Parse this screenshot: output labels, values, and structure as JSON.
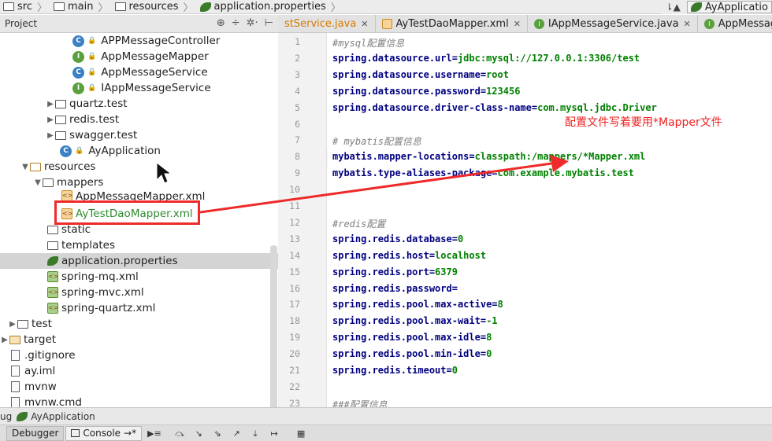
{
  "breadcrumb": {
    "items": [
      {
        "label": "src",
        "icon": "folder-icon"
      },
      {
        "label": "main",
        "icon": "folder-icon"
      },
      {
        "label": "resources",
        "icon": "folder-icon"
      },
      {
        "label": "application.properties",
        "icon": "spring-leaf-icon"
      }
    ],
    "run_config": "AyApplicatio"
  },
  "project_panel": {
    "title": "Project"
  },
  "tree": [
    {
      "label": "APPMessageController",
      "icon": "class-icon"
    },
    {
      "label": "AppMessageMapper",
      "icon": "interface-icon"
    },
    {
      "label": "AppMessageService",
      "icon": "class-icon"
    },
    {
      "label": "IAppMessageService",
      "icon": "interface-icon"
    },
    {
      "label": "quartz.test",
      "icon": "package-icon"
    },
    {
      "label": "redis.test",
      "icon": "package-icon"
    },
    {
      "label": "swagger.test",
      "icon": "package-icon"
    },
    {
      "label": "AyApplication",
      "icon": "spring-class-icon"
    },
    {
      "label": "resources",
      "icon": "resources-folder-icon"
    },
    {
      "label": "mappers",
      "icon": "folder-icon"
    },
    {
      "label": "AppMessageMapper.xml",
      "icon": "xml-icon"
    },
    {
      "label": "AyTestDaoMapper.xml",
      "icon": "xml-icon"
    },
    {
      "label": "static",
      "icon": "folder-icon"
    },
    {
      "label": "templates",
      "icon": "folder-icon"
    },
    {
      "label": "application.properties",
      "icon": "spring-leaf-icon"
    },
    {
      "label": "spring-mq.xml",
      "icon": "spring-xml-icon"
    },
    {
      "label": "spring-mvc.xml",
      "icon": "spring-xml-icon"
    },
    {
      "label": "spring-quartz.xml",
      "icon": "spring-xml-icon"
    },
    {
      "label": "test",
      "icon": "folder-icon"
    },
    {
      "label": "target",
      "icon": "folder-icon"
    },
    {
      "label": ".gitignore",
      "icon": "file-icon"
    },
    {
      "label": "ay.iml",
      "icon": "file-icon"
    },
    {
      "label": "mvnw",
      "icon": "file-icon"
    },
    {
      "label": "mvnw.cmd",
      "icon": "file-icon"
    }
  ],
  "tabs": [
    {
      "label": "stService.java"
    },
    {
      "label": "AyTestDaoMapper.xml"
    },
    {
      "label": "IAppMessageService.java"
    },
    {
      "label": "AppMessageMap"
    }
  ],
  "editor": {
    "lines": [
      {
        "n": "1",
        "k": "#mysql配置信息",
        "v": "",
        "comment": true
      },
      {
        "n": "2",
        "k": "spring.datasource.url=",
        "v": "jdbc:mysql://127.0.0.1:3306/test",
        "comment": false
      },
      {
        "n": "3",
        "k": "spring.datasource.username=",
        "v": "root",
        "comment": false
      },
      {
        "n": "4",
        "k": "spring.datasource.password=",
        "v": "123456",
        "comment": false
      },
      {
        "n": "5",
        "k": "spring.datasource.driver-class-name=",
        "v": "com.mysql.jdbc.Driver",
        "comment": false
      },
      {
        "n": "6",
        "k": "",
        "v": "",
        "comment": false
      },
      {
        "n": "7",
        "k": "# mybatis配置信息",
        "v": "",
        "comment": true
      },
      {
        "n": "8",
        "k": "mybatis.mapper-locations=",
        "v": "classpath:/mappers/*Mapper.xml",
        "comment": false
      },
      {
        "n": "9",
        "k": "mybatis.type-aliases-package=",
        "v": "com.example.mybatis.test",
        "comment": false
      },
      {
        "n": "10",
        "k": "",
        "v": "",
        "comment": false
      },
      {
        "n": "11",
        "k": "",
        "v": "",
        "comment": false
      },
      {
        "n": "12",
        "k": "#redis配置",
        "v": "",
        "comment": true
      },
      {
        "n": "13",
        "k": "spring.redis.database=",
        "v": "0",
        "comment": false
      },
      {
        "n": "14",
        "k": "spring.redis.host=",
        "v": "localhost",
        "comment": false
      },
      {
        "n": "15",
        "k": "spring.redis.port=",
        "v": "6379",
        "comment": false
      },
      {
        "n": "16",
        "k": "spring.redis.password=",
        "v": "",
        "comment": false
      },
      {
        "n": "17",
        "k": "spring.redis.pool.max-active=",
        "v": "8",
        "comment": false
      },
      {
        "n": "18",
        "k": "spring.redis.pool.max-wait=",
        "v": "-1",
        "comment": false
      },
      {
        "n": "19",
        "k": "spring.redis.pool.max-idle=",
        "v": "8",
        "comment": false
      },
      {
        "n": "20",
        "k": "spring.redis.pool.min-idle=",
        "v": "0",
        "comment": false
      },
      {
        "n": "21",
        "k": "spring.redis.timeout=",
        "v": "0",
        "comment": false
      },
      {
        "n": "22",
        "k": "",
        "v": "",
        "comment": false
      },
      {
        "n": "23",
        "k": "###配置信息",
        "v": "",
        "comment": true
      }
    ],
    "annotation": "配置文件写着要用*Mapper文件"
  },
  "debug_bar": {
    "prefix": "ug",
    "config": "AyApplication"
  },
  "bottom_toolbar": {
    "debugger": "Debugger",
    "console": "Console",
    "console_suffix": "→*"
  },
  "colors": {
    "highlight": "#ee2a2a",
    "key": "#000080",
    "value": "#008000",
    "comment": "#808080"
  }
}
